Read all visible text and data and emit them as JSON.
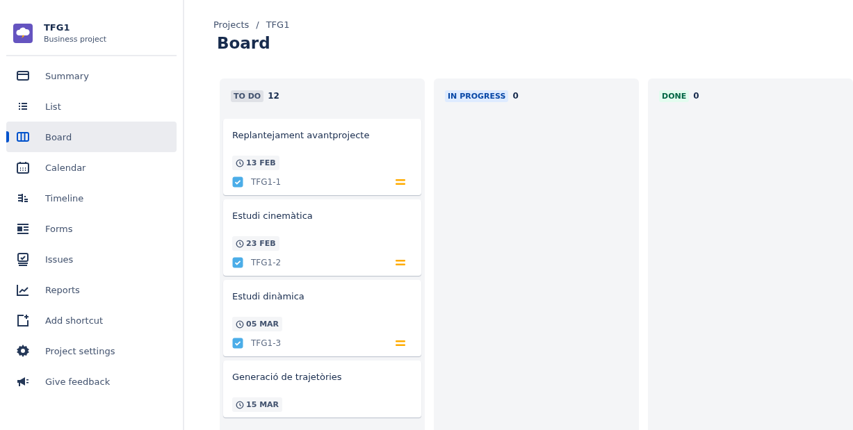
{
  "project": {
    "name": "TFG1",
    "type": "Business project"
  },
  "sidebar": {
    "items": [
      {
        "label": "Summary",
        "selected": false
      },
      {
        "label": "List",
        "selected": false
      },
      {
        "label": "Board",
        "selected": true
      },
      {
        "label": "Calendar",
        "selected": false
      },
      {
        "label": "Timeline",
        "selected": false
      },
      {
        "label": "Forms",
        "selected": false
      },
      {
        "label": "Issues",
        "selected": false
      },
      {
        "label": "Reports",
        "selected": false
      },
      {
        "label": "Add shortcut",
        "selected": false
      },
      {
        "label": "Project settings",
        "selected": false
      },
      {
        "label": "Give feedback",
        "selected": false
      }
    ]
  },
  "breadcrumbs": [
    "Projects",
    "/",
    "TFG1"
  ],
  "title": "Board",
  "columns": [
    {
      "status": "TO DO",
      "kind": "todo",
      "count": "12",
      "cards": [
        {
          "title": "Replantejament avantprojecte",
          "due": "13 FEB",
          "key": "TFG1-1",
          "checked": true,
          "priority": {
            "kind": "medium"
          }
        },
        {
          "title": "Estudi cinemàtica",
          "due": "23 FEB",
          "key": "TFG1-2",
          "checked": true,
          "priority": {
            "kind": "medium"
          }
        },
        {
          "title": "Estudi dinàmica",
          "due": "05 MAR",
          "key": "TFG1-3",
          "checked": true,
          "priority": {
            "kind": "medium"
          }
        },
        {
          "title": "Generació de trajetòries",
          "due": "15 MAR"
        }
      ]
    },
    {
      "status": "IN PROGRESS",
      "kind": "inprogress",
      "count": "0"
    },
    {
      "status": "DONE",
      "kind": "done",
      "count": "0"
    }
  ]
}
